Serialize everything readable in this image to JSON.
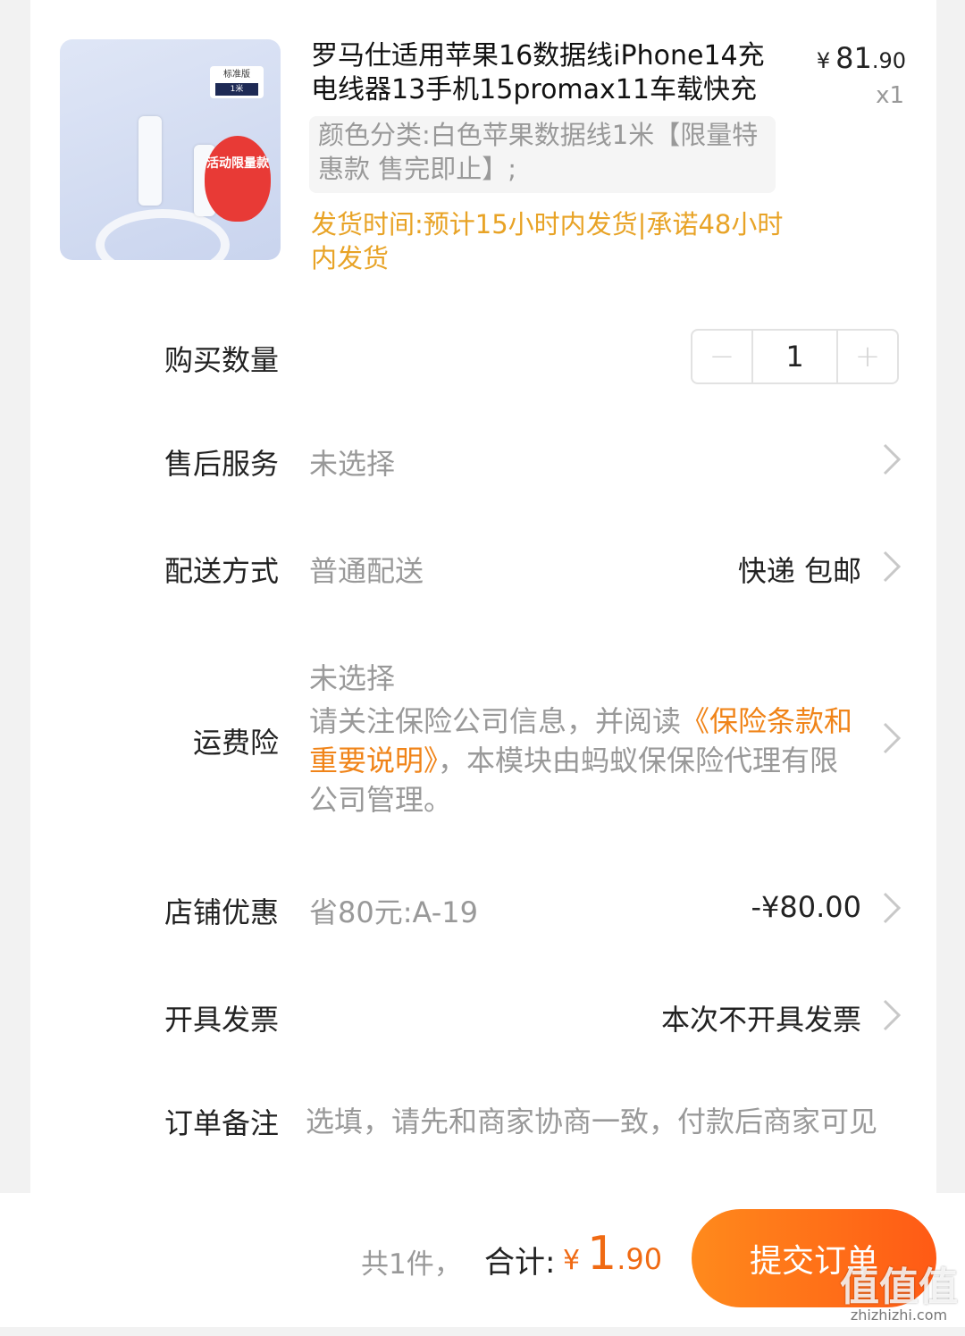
{
  "product": {
    "title": "罗马仕适用苹果16数据线iPhone14充电线器13手机15promax11车载快充",
    "price_currency": "¥",
    "price_int": "81",
    "price_dec": ".90",
    "quantity_label": "x1",
    "sku": "颜色分类:白色苹果数据线1米【限量特惠款 售完即止】;",
    "ship_time": "发货时间:预计15小时内发货|承诺48小时内发货",
    "image": {
      "tag": "标准版",
      "tag_sub": "1米",
      "promo": "活动限量款"
    }
  },
  "rows": {
    "quantity": {
      "label": "购买数量",
      "value": "1",
      "minus": "−",
      "plus": "+"
    },
    "after_sale": {
      "label": "售后服务",
      "value": "未选择"
    },
    "delivery": {
      "label": "配送方式",
      "value": "普通配送",
      "right": "快递 包邮"
    },
    "shipping_insurance": {
      "label": "运费险",
      "value": "未选择",
      "desc_pre": "请关注保险公司信息，并阅读",
      "desc_link": "《保险条款和重要说明》",
      "desc_post": "，本模块由蚂蚁保保险代理有限公司管理。"
    },
    "store_discount": {
      "label": "店铺优惠",
      "value": "省80元:A-19",
      "right": "-¥80.00"
    },
    "invoice": {
      "label": "开具发票",
      "right": "本次不开具发票"
    },
    "remark": {
      "label": "订单备注",
      "placeholder": "选填，请先和商家协商一致，付款后商家可见"
    }
  },
  "footer": {
    "count": "共1件，",
    "total_label": "合计:",
    "total_currency": "¥",
    "total_int": "1",
    "total_dec": ".90",
    "submit": "提交订单"
  },
  "watermark": {
    "text": "值值值",
    "url": "zhizhizhi.com"
  },
  "colors": {
    "accent": "#f06a13",
    "ship_time": "#e8a326",
    "link": "#f08419"
  }
}
